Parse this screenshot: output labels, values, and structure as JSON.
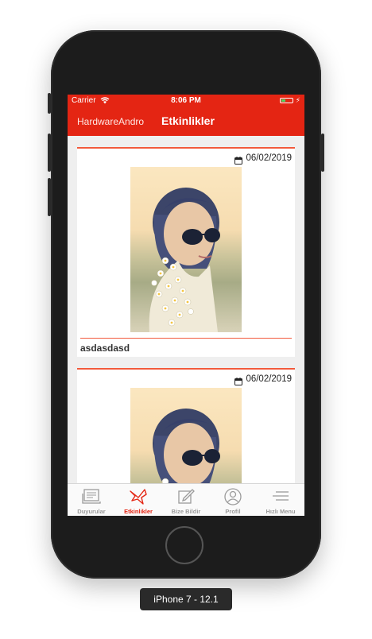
{
  "status_bar": {
    "carrier": "Carrier",
    "time": "8:06 PM"
  },
  "nav": {
    "back_label": "HardwareAndro",
    "title": "Etkinlikler"
  },
  "events": [
    {
      "date": "06/02/2019",
      "name": "asdasdasd"
    },
    {
      "date": "06/02/2019",
      "name": ""
    }
  ],
  "tabs": [
    {
      "label": "Duyurular",
      "icon": "newspaper-icon",
      "active": false
    },
    {
      "label": "Etkinlikler",
      "icon": "bird-icon",
      "active": true
    },
    {
      "label": "Bize Bildir",
      "icon": "edit-icon",
      "active": false
    },
    {
      "label": "Profil",
      "icon": "profile-icon",
      "active": false
    },
    {
      "label": "Hızlı Menu",
      "icon": "menu-icon",
      "active": false
    }
  ],
  "device_label": "iPhone 7 - 12.1",
  "colors": {
    "accent": "#e42513",
    "divider": "#f25a3c",
    "inactive_tab": "#9b9b9b"
  }
}
